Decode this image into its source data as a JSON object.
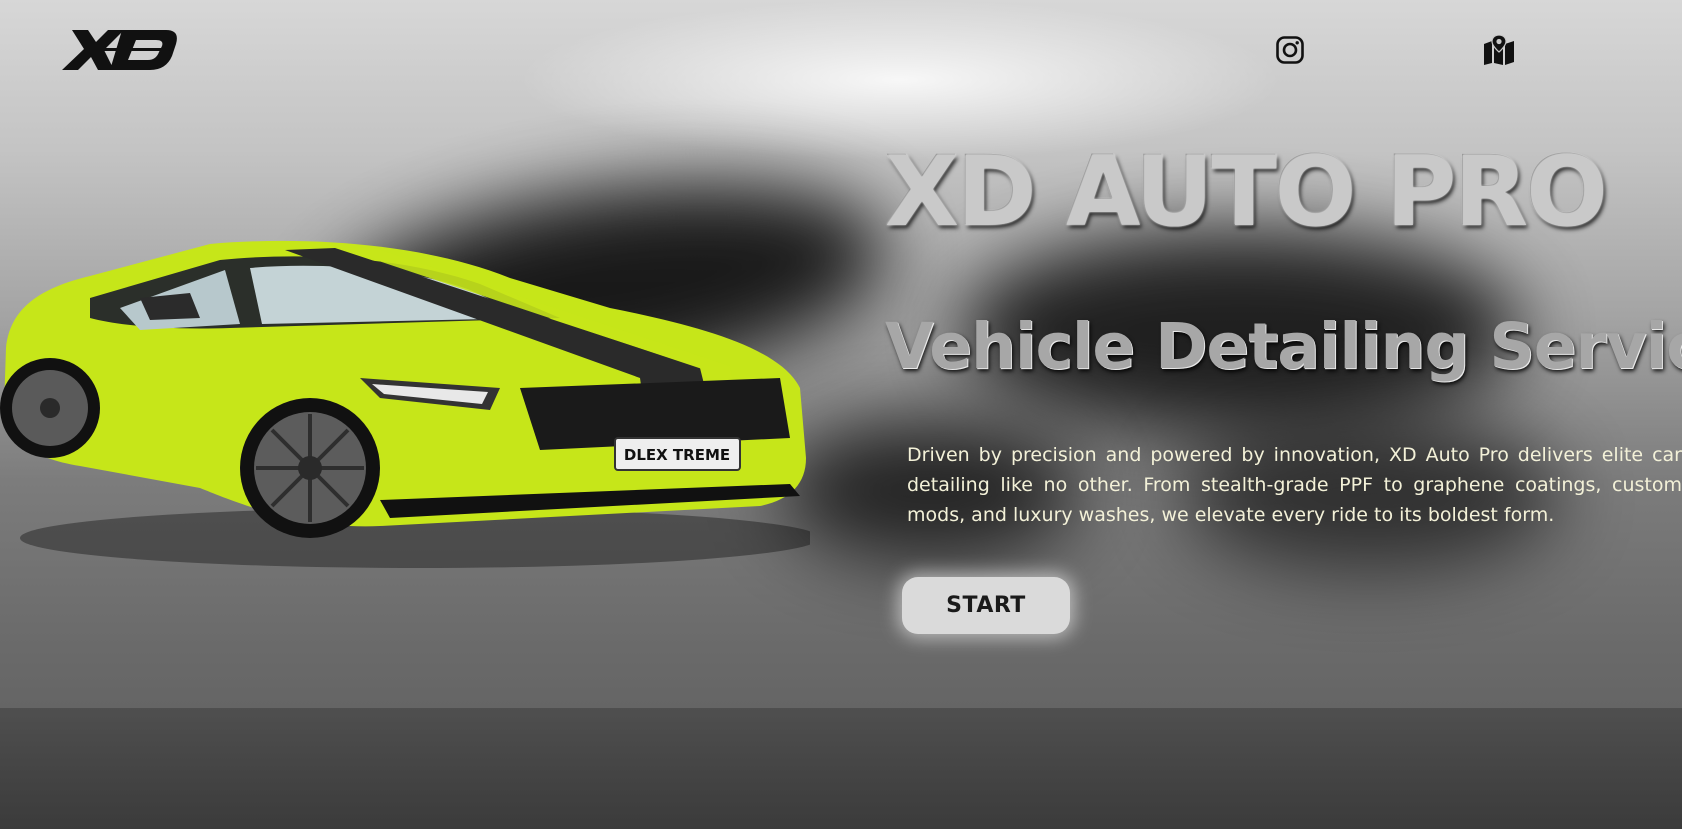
{
  "header": {
    "logo_text": "XD",
    "instagram_icon": "instagram-icon",
    "map_icon": "map-icon"
  },
  "hero": {
    "title": "XD AUTO PRO",
    "subtitle": "Vehicle Detailing Service",
    "description": "Driven by precision and powered by innovation, XD Auto Pro delivers elite car detailing like no other. From stealth-grade PPF to graphene coatings, custom mods, and luxury washes, we elevate every ride to its boldest form.",
    "cta_label": "START"
  },
  "car": {
    "plate_text": "DLEX TREME",
    "body_color": "#c6e619",
    "stripe_color": "#2a2a2a"
  },
  "colors": {
    "title": "#c9c9c9",
    "description": "#f3f1d8",
    "button_bg": "#dadada"
  }
}
